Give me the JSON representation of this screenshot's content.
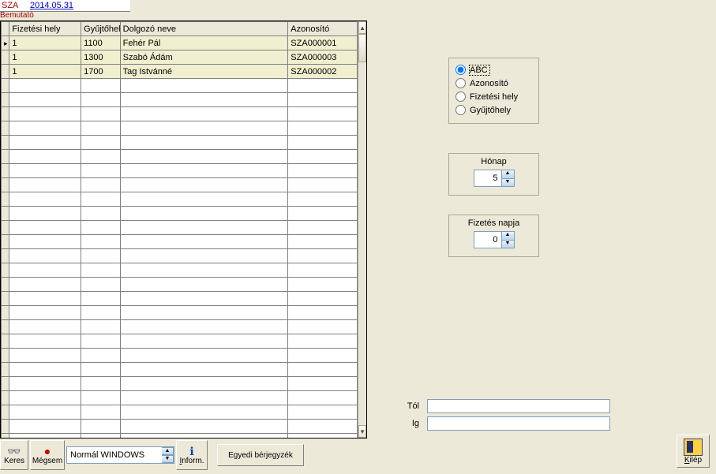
{
  "header": {
    "code": "SZA",
    "date": "2014.05.31",
    "subtitle": "Bemutató"
  },
  "grid": {
    "columns": [
      "Fizetési hely",
      "Gyűjtőhely",
      "Dolgozó neve",
      "Azonosító"
    ],
    "rows": [
      {
        "fh": "1",
        "gy": "1100",
        "nev": "Fehér Pál",
        "az": "SZA000001"
      },
      {
        "fh": "1",
        "gy": "1300",
        "nev": "Szabó Ádám",
        "az": "SZA000003"
      },
      {
        "fh": "1",
        "gy": "1700",
        "nev": "Tag Istvánné",
        "az": "SZA000002"
      }
    ],
    "empty_rows": 28
  },
  "sort": {
    "options": [
      "ABC",
      "Azonosító",
      "Fizetési hely",
      "Gyűjtőhely"
    ],
    "selected": "ABC"
  },
  "month": {
    "label": "Hónap",
    "value": "5"
  },
  "payday": {
    "label": "Fizetés napja",
    "value": "0"
  },
  "range": {
    "from_label": "Tól",
    "from_value": "",
    "to_label": "Ig",
    "to_value": ""
  },
  "toolbar": {
    "keres": "Keres",
    "megsem": "Mégsem",
    "combo": "Normál WINDOWS",
    "inform": "Inform.",
    "egyedi": "Egyedi bérjegyzék"
  },
  "exit": {
    "label": "Kilép"
  }
}
